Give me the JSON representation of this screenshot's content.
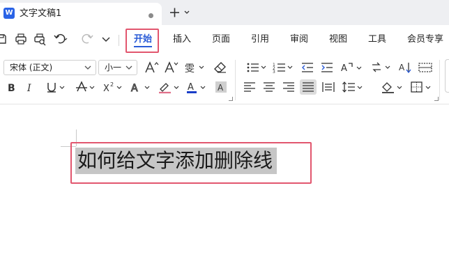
{
  "app": {
    "logo_letter": "W",
    "doc_tab_title": "文字文稿1",
    "accent": "#2a5bd7",
    "highlight": "#e2566e"
  },
  "quick_access": {
    "icons": [
      "save-icon",
      "print-icon",
      "print-preview-icon",
      "undo-icon",
      "redo-icon",
      "more-icon"
    ]
  },
  "menu": {
    "items": [
      "开始",
      "插入",
      "页面",
      "引用",
      "审阅",
      "视图",
      "工具",
      "会员专享"
    ],
    "active": "开始"
  },
  "toolbar": {
    "font_name": "宋体 (正文)",
    "font_size": "小一",
    "font_color": "#1a3ec8"
  },
  "document": {
    "selected_text": "如何给文字添加删除线"
  }
}
